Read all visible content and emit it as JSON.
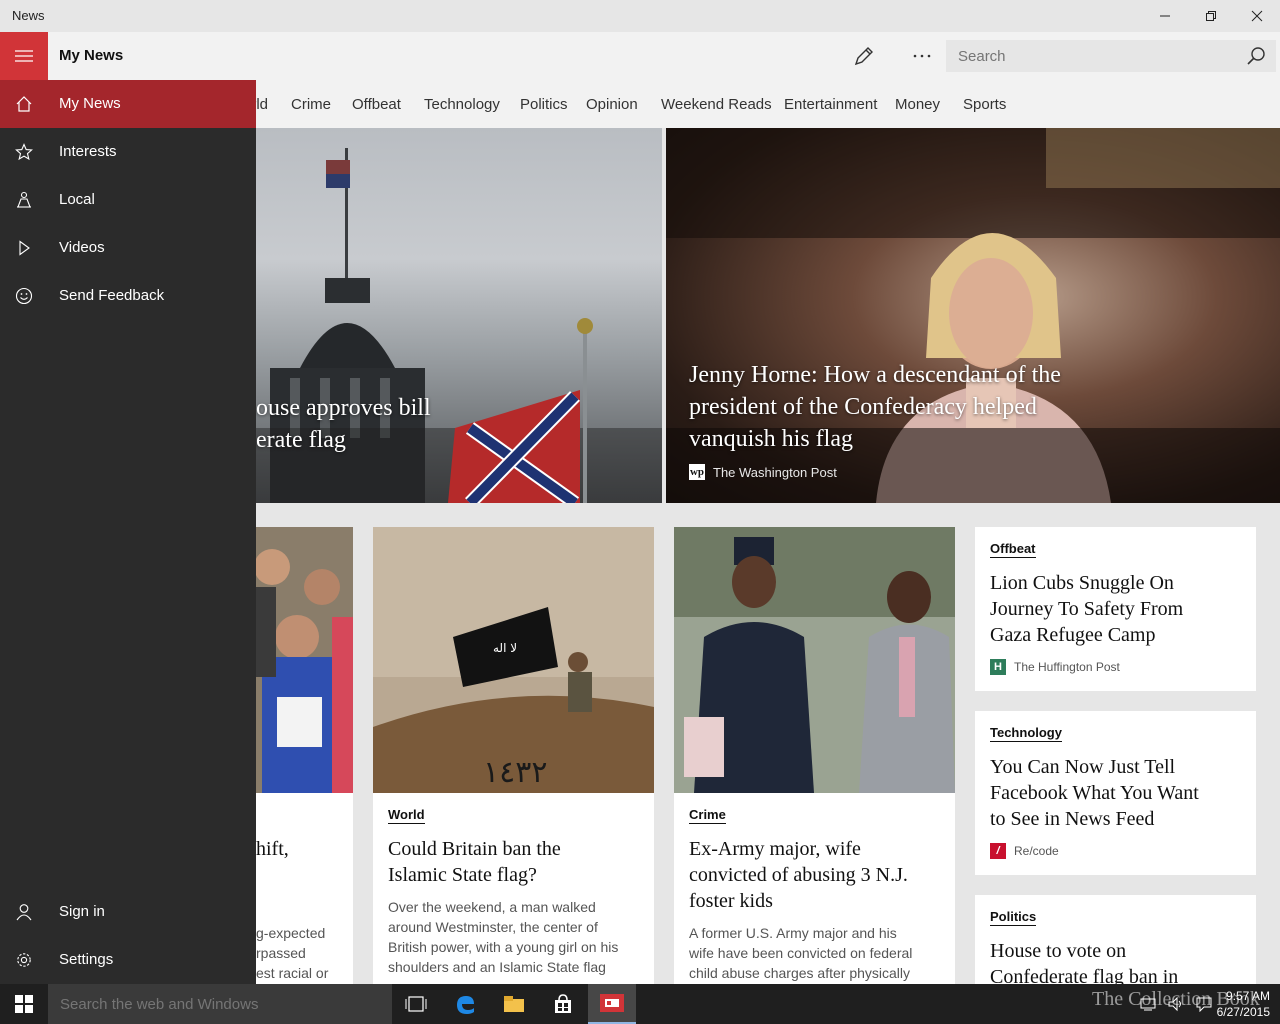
{
  "window": {
    "title": "News"
  },
  "header": {
    "app_title": "My News",
    "search_placeholder": "Search"
  },
  "categories": [
    "rld",
    "Crime",
    "Offbeat",
    "Technology",
    "Politics",
    "Opinion",
    "Weekend Reads",
    "Entertainment",
    "Money",
    "Sports"
  ],
  "hero": [
    {
      "title_lines": [
        "ouse approves bill",
        "erate flag"
      ]
    },
    {
      "title_lines": [
        "Jenny Horne: How a descendant of the",
        "president of the Confederacy helped",
        "vanquish his flag"
      ],
      "source": "The Washington Post"
    }
  ],
  "cards": [
    {
      "title_partial": "hift,",
      "summary_lines": [
        "g-expected",
        "rpassed",
        "est racial or"
      ]
    },
    {
      "category": "World",
      "title_lines": [
        "Could Britain ban the",
        "Islamic State flag?"
      ],
      "summary_lines": [
        "Over the weekend, a man walked",
        "around Westminster, the center of",
        "British power, with a young girl on his",
        "shoulders and an Islamic State flag"
      ]
    },
    {
      "category": "Crime",
      "title_lines": [
        "Ex-Army major, wife",
        "convicted of abusing 3 N.J.",
        "foster kids"
      ],
      "summary_lines": [
        "A former U.S. Army major and his",
        "wife have been convicted on federal",
        "child abuse charges after physically"
      ]
    }
  ],
  "side_cards": [
    {
      "category": "Offbeat",
      "title_lines": [
        "Lion Cubs Snuggle On",
        "Journey To Safety From",
        "Gaza Refugee Camp"
      ],
      "source": "The Huffington Post"
    },
    {
      "category": "Technology",
      "title_lines": [
        "You Can Now Just Tell",
        "Facebook What You Want",
        "to See in News Feed"
      ],
      "source": "Re/code"
    },
    {
      "category": "Politics",
      "title_lines": [
        "House to vote on",
        "Confederate flag ban in"
      ]
    }
  ],
  "nav": {
    "items": [
      {
        "label": "My News",
        "icon": "home-icon"
      },
      {
        "label": "Interests",
        "icon": "star-icon"
      },
      {
        "label": "Local",
        "icon": "local-icon"
      },
      {
        "label": "Videos",
        "icon": "play-icon"
      },
      {
        "label": "Send Feedback",
        "icon": "smiley-icon"
      }
    ],
    "bottom": [
      {
        "label": "Sign in",
        "icon": "person-icon"
      },
      {
        "label": "Settings",
        "icon": "gear-icon"
      }
    ]
  },
  "taskbar": {
    "search_placeholder": "Search the web and Windows",
    "time": "9:57 AM",
    "date": "6/27/2015"
  },
  "watermark": "The Collection Book",
  "colors": {
    "accent": "#d13438",
    "nav_active": "#a4262c",
    "nav_bg": "#2b2b2b"
  }
}
